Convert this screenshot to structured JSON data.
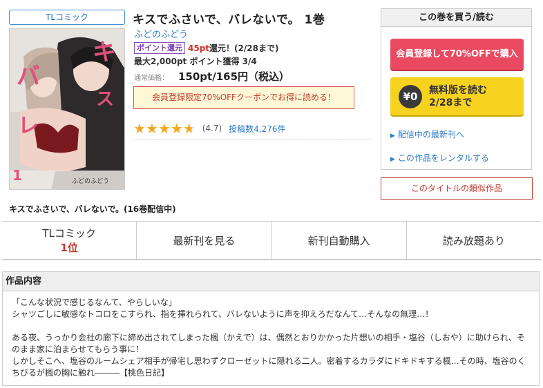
{
  "genre_tag": "TLコミック",
  "cover": {
    "vertical_title": "キスでふさいで、",
    "volume_mark": "1",
    "author_on_cover": "ふどのふどう",
    "colors": {
      "accent": "#e04f7b",
      "bg": "#d9d6d3",
      "lace": "#7a1a1f"
    }
  },
  "book": {
    "title": "キスでふさいで、バレないで。 1巻",
    "author": "ふどのふどう",
    "point_badge": "ポイント還元",
    "point_amount": "45pt",
    "point_rest": "還元！(2/28まで)",
    "max_points": "最大2,000pt ポイント獲得 3/4",
    "price_label": "通常価格：",
    "price": "150pt/165円（税込）",
    "coupon": "会員登録限定70%OFFクーポンでお得に読める！",
    "rating_text": "(4.7)",
    "rating_value": 4.7,
    "review_count": "投稿数4,276件"
  },
  "buy_panel": {
    "header": "この巻を買う/読む",
    "member_button": "会員登録して70%OFFで購入",
    "free_icon": "¥0",
    "free_line1": "無料版を読む",
    "free_line2": "2/28まで",
    "link_latest": "配信中の最新刊へ",
    "link_rental": "この作品をレンタルする"
  },
  "similar_button": "このタイトルの類似作品",
  "series_line": "キスでふさいで、バレないで。(16巻配信中)",
  "tabs": [
    {
      "label": "TLコミック",
      "rank": "1位"
    },
    {
      "label": "最新刊を見る"
    },
    {
      "label": "新刊自動購入"
    },
    {
      "label": "読み放題あり"
    }
  ],
  "description": {
    "header": "作品内容",
    "lines": [
      "「こんな状況で感じるなんて、やらしいな」",
      "シャツごしに敏感なトコロをこすられ、指を挿れられて、バレないように声を抑えろだなんて…そんなの無理…！",
      "",
      "ある夜、うっかり会社の廊下に締め出されてしまった楓（かえで）は、偶然とおりかかった片想いの相手・塩谷（しおや）に助けられ、そ",
      "のまま家に泊まらせてもらう事に！",
      "しかしそこへ、塩谷のルームシェア相手が帰宅し思わずクローゼットに隠れる二人。密着するカラダにドキドキする楓…その時、塩谷のく",
      "ちびるが楓の胸に触れ―――【桃色日記】"
    ]
  }
}
